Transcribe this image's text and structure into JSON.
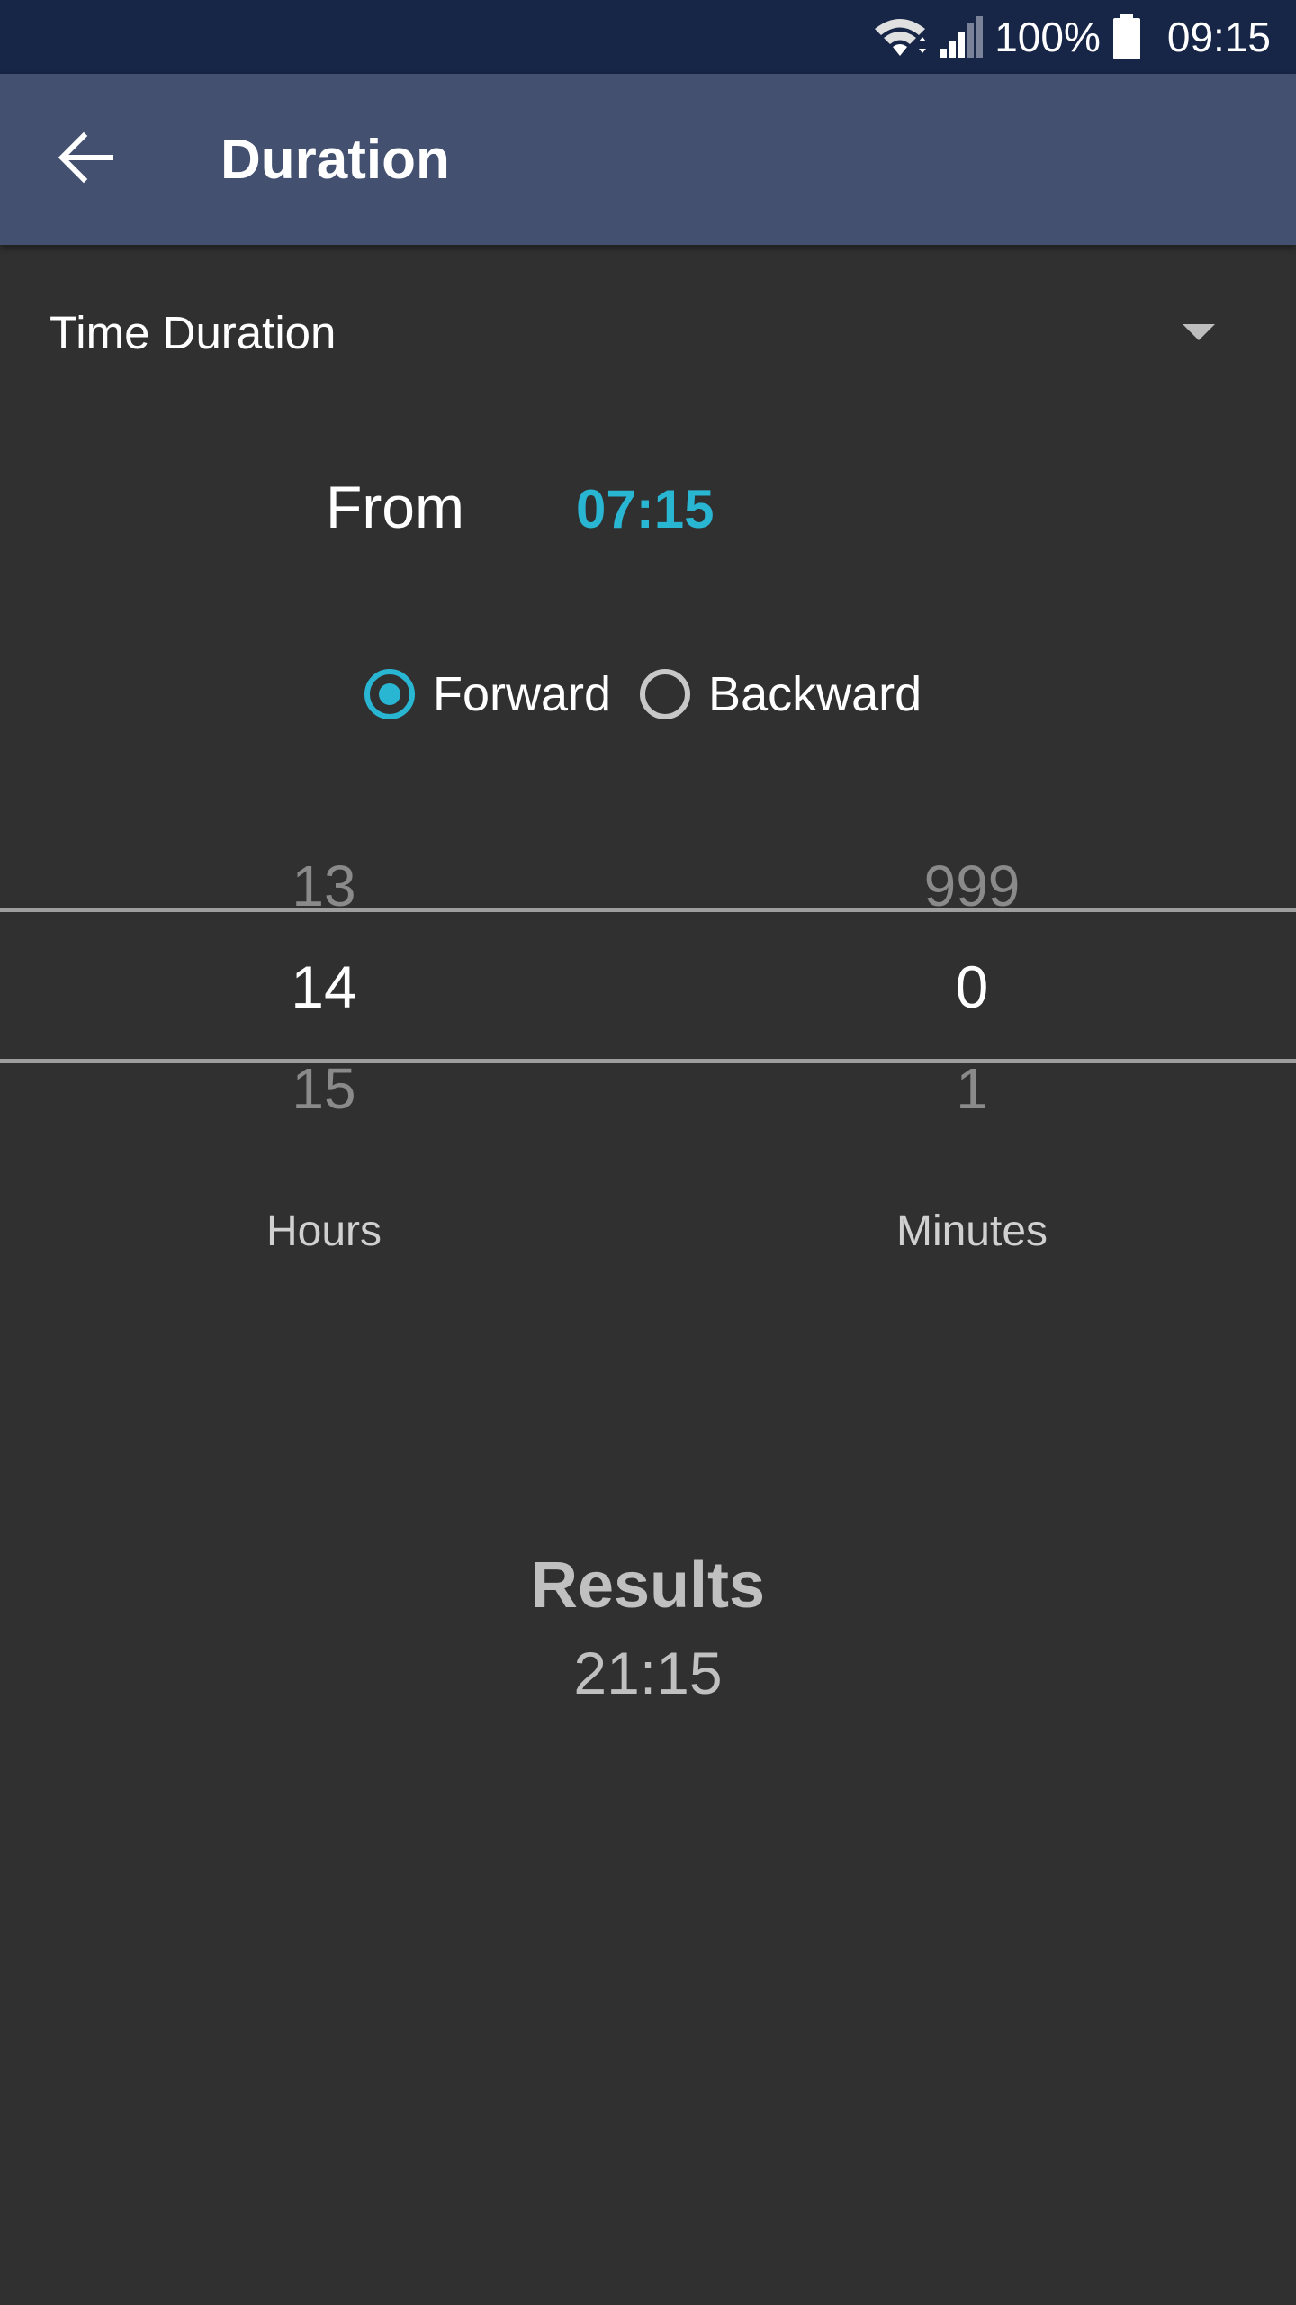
{
  "status_bar": {
    "battery": "100%",
    "time": "09:15",
    "icons": [
      "wifi-icon",
      "signal-icon",
      "battery-icon"
    ]
  },
  "app_bar": {
    "back_icon": "arrow-left-icon",
    "title": "Duration"
  },
  "mode_selector": {
    "selected": "Time Duration",
    "dropdown_icon": "caret-down-icon"
  },
  "from": {
    "label": "From",
    "value": "07:15"
  },
  "direction": {
    "options": [
      "Forward",
      "Backward"
    ],
    "selected": "Forward"
  },
  "pickers": {
    "hours": {
      "caption": "Hours",
      "prev": "13",
      "current": "14",
      "next": "15"
    },
    "minutes": {
      "caption": "Minutes",
      "prev": "999",
      "current": "0",
      "next": "1"
    }
  },
  "results": {
    "title": "Results",
    "value": "21:15"
  },
  "colors": {
    "status_bar": "#172546",
    "app_bar": "#43506f",
    "background": "#303030",
    "accent": "#29b6d3"
  }
}
